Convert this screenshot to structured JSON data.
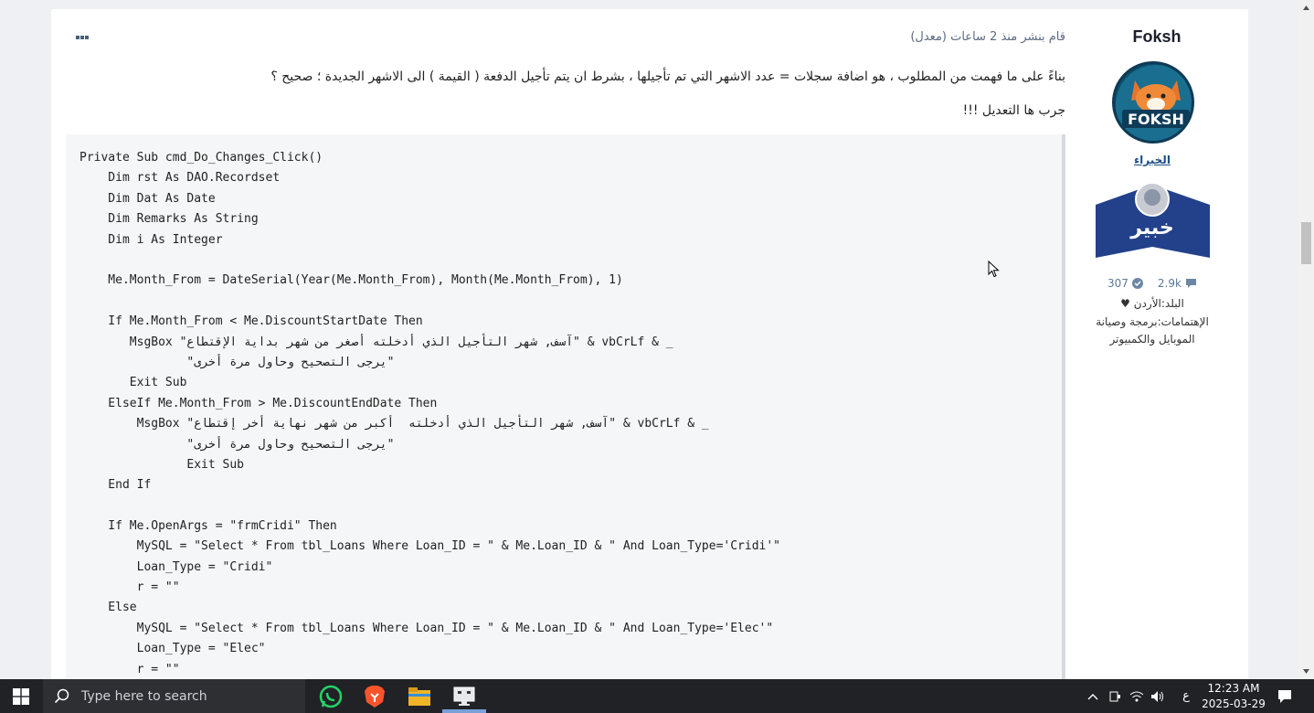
{
  "author": {
    "name": "Foksh",
    "avatar_text": "FOKSH",
    "rank": "الخبراء",
    "badge_text": "خبير",
    "stats": {
      "posts": "2.9k",
      "reputation": "307"
    },
    "country_line": "البلد:الأردن ♥",
    "interests_line1": "الإهتمامات:برمجة وصيانة",
    "interests_line2": "الموبايل والكمبيوتر"
  },
  "post": {
    "timestamp": "قام بنشر منذ 2 ساعات (معدل)",
    "text1": "بناءً على ما فهمت من المطلوب ، هو اضافة سجلات = عدد الاشهر التي تم تأجيلها ، بشرط ان يتم تأجيل الدفعة ( القيمة ) الى الاشهر الجديدة ؛ صحيح ؟",
    "text2": "جرب ها التعديل !!!",
    "code_lines": [
      "Private Sub cmd_Do_Changes_Click()",
      "    Dim rst As DAO.Recordset",
      "    Dim Dat As Date",
      "    Dim Remarks As String",
      "    Dim i As Integer",
      "",
      "    Me.Month_From = DateSerial(Year(Me.Month_From), Month(Me.Month_From), 1)",
      "",
      "    If Me.Month_From < Me.DiscountStartDate Then",
      "       MsgBox \"آسف, شهر التأجيل الذي أدخلته أصغر من شهر بداية الإقتطاع\" & vbCrLf & _",
      "               \"يرجى التصحيح وحاول مرة أخرى\"",
      "       Exit Sub",
      "    ElseIf Me.Month_From > Me.DiscountEndDate Then",
      "        MsgBox \"آسف, شهر التأجيل الذي أدخلته  أكبر من شهر نهاية أخر إقتطاع\" & vbCrLf & _",
      "               \"يرجى التصحيح وحاول مرة أخرى\"",
      "               Exit Sub",
      "    End If",
      "",
      "    If Me.OpenArgs = \"frmCridi\" Then",
      "        MySQL = \"Select * From tbl_Loans Where Loan_ID = \" & Me.Loan_ID & \" And Loan_Type='Cridi'\"",
      "        Loan_Type = \"Cridi\"",
      "        r = \"\"",
      "    Else",
      "        MySQL = \"Select * From tbl_Loans Where Loan_ID = \" & Me.Loan_ID & \" And Loan_Type='Elec'\"",
      "        Loan_Type = \"Elec\"",
      "        r = \"\""
    ]
  },
  "taskbar": {
    "search_placeholder": "Type here to search",
    "lang": "ع",
    "time": "12:23 AM",
    "date": "2025-03-29"
  },
  "colors": {
    "accent": "#1f4e8a",
    "badge_blue": "#22418a",
    "code_bg": "#f5f6f7"
  }
}
